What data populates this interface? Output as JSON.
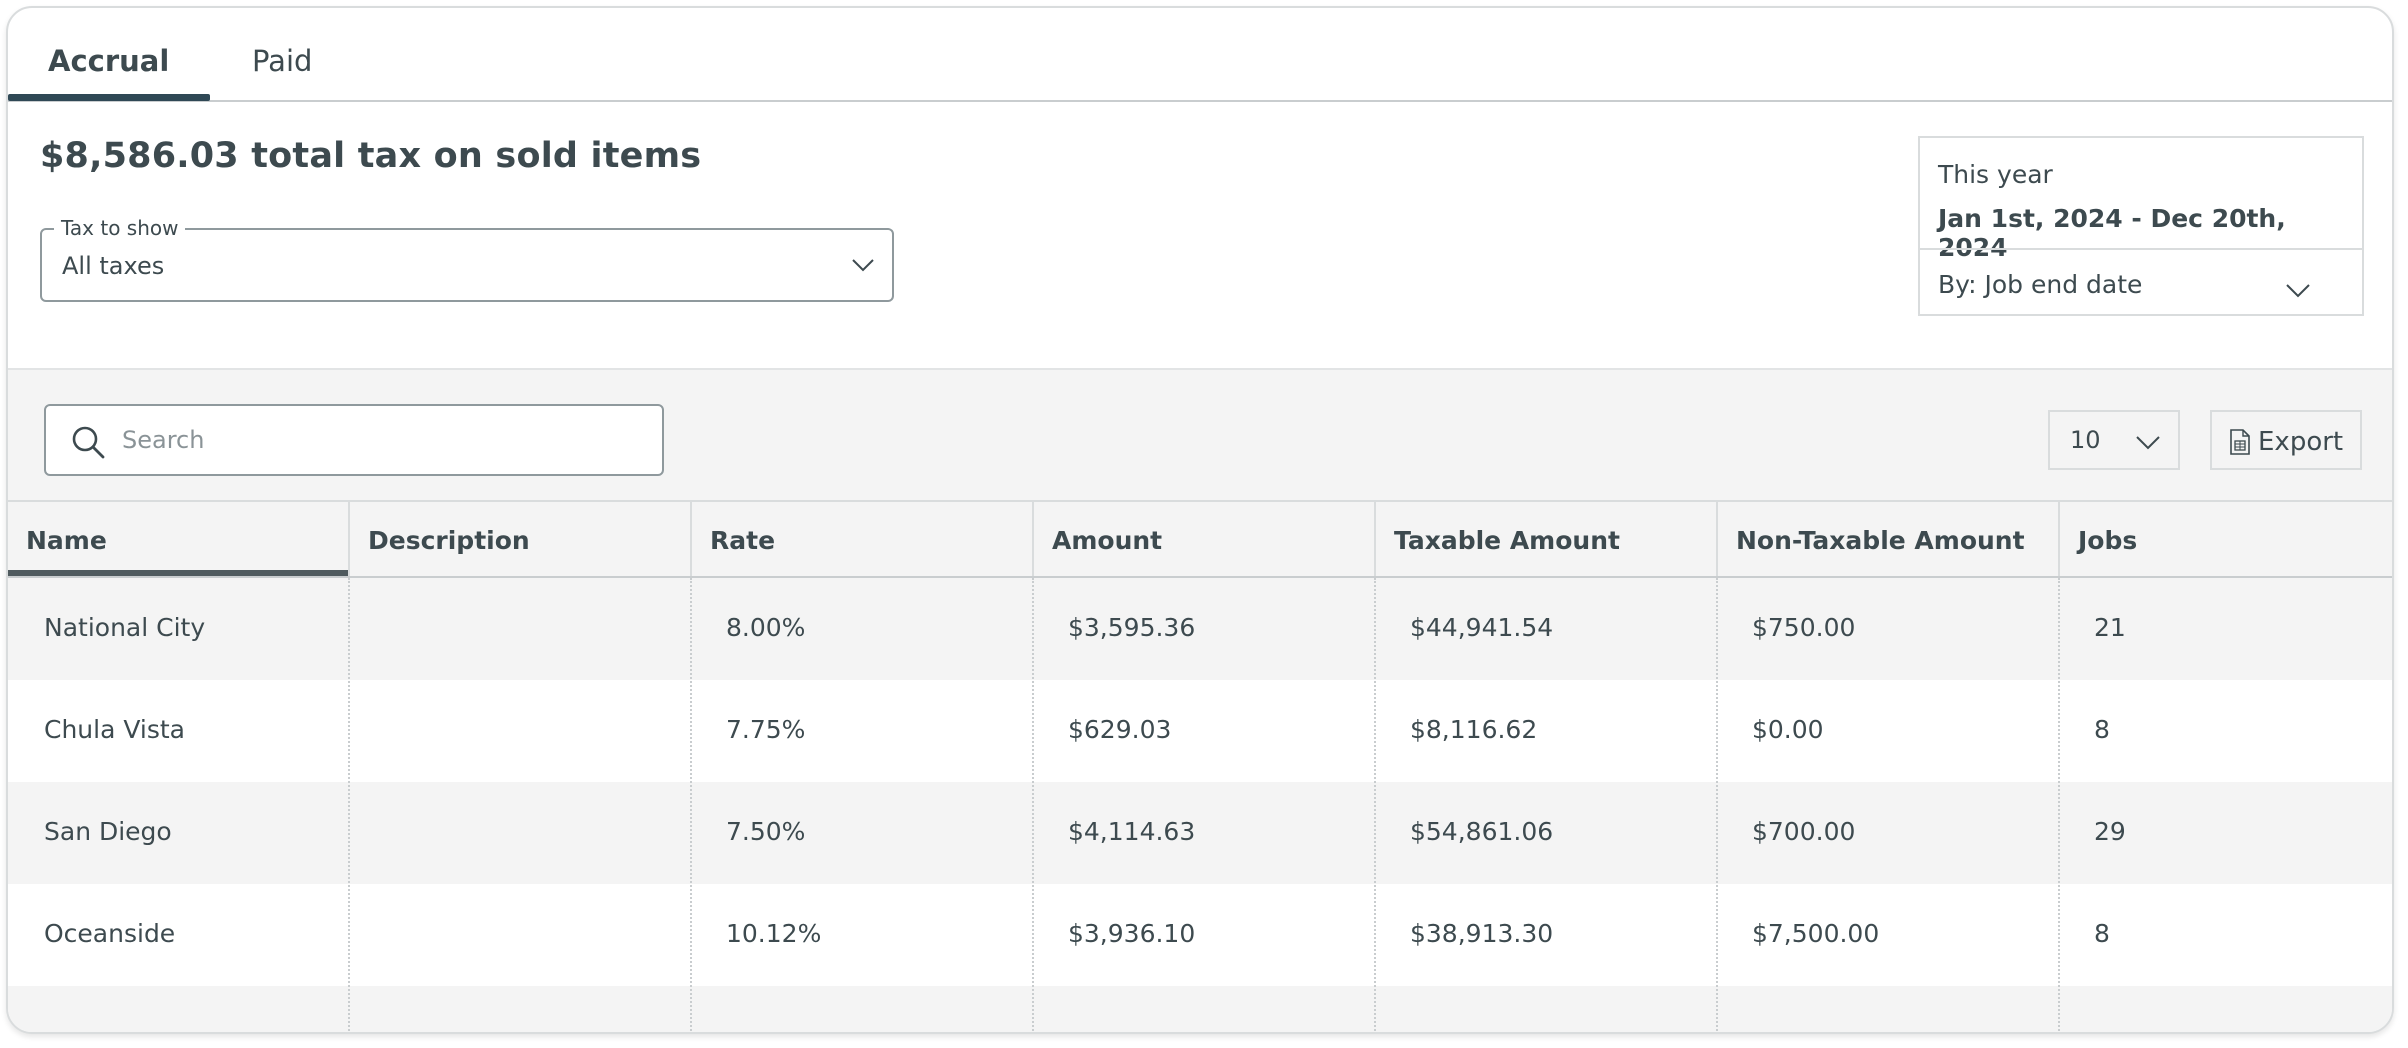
{
  "tabs": [
    {
      "label": "Accrual",
      "active": true
    },
    {
      "label": "Paid",
      "active": false
    }
  ],
  "summary": {
    "headline": "$8,586.03 total tax on sold items"
  },
  "tax_filter": {
    "legend": "Tax to show",
    "value": "All taxes",
    "icon": "chevron-down-icon"
  },
  "date_range": {
    "period": "This year",
    "range": "Jan 1st, 2024 - Dec 20th, 2024",
    "by": "By: Job end date",
    "icon": "chevron-down-icon"
  },
  "search": {
    "placeholder": "Search",
    "value": "",
    "icon": "search-icon"
  },
  "pagination": {
    "page_size": "10",
    "icon": "chevron-down-icon"
  },
  "export": {
    "label": "Export",
    "icon": "spreadsheet-icon"
  },
  "table": {
    "sorted_column": "Name",
    "columns": [
      "Name",
      "Description",
      "Rate",
      "Amount",
      "Taxable Amount",
      "Non-Taxable Amount",
      "Jobs"
    ],
    "rows": [
      {
        "name": "National City",
        "description": "",
        "rate": "8.00%",
        "amount": "$3,595.36",
        "taxable": "$44,941.54",
        "non_taxable": "$750.00",
        "jobs": "21"
      },
      {
        "name": "Chula Vista",
        "description": "",
        "rate": "7.75%",
        "amount": "$629.03",
        "taxable": "$8,116.62",
        "non_taxable": "$0.00",
        "jobs": "8"
      },
      {
        "name": "San Diego",
        "description": "",
        "rate": "7.50%",
        "amount": "$4,114.63",
        "taxable": "$54,861.06",
        "non_taxable": "$700.00",
        "jobs": "29"
      },
      {
        "name": "Oceanside",
        "description": "",
        "rate": "10.12%",
        "amount": "$3,936.10",
        "taxable": "$38,913.30",
        "non_taxable": "$7,500.00",
        "jobs": "8"
      },
      {
        "name": "",
        "description": "",
        "rate": "",
        "amount": "",
        "taxable": "",
        "non_taxable": "",
        "jobs": ""
      }
    ]
  },
  "colors": {
    "text": "#3d4a4f",
    "tab_indicator": "#2f4855",
    "stripe": "#f4f4f4",
    "border": "#d9dcdd"
  }
}
